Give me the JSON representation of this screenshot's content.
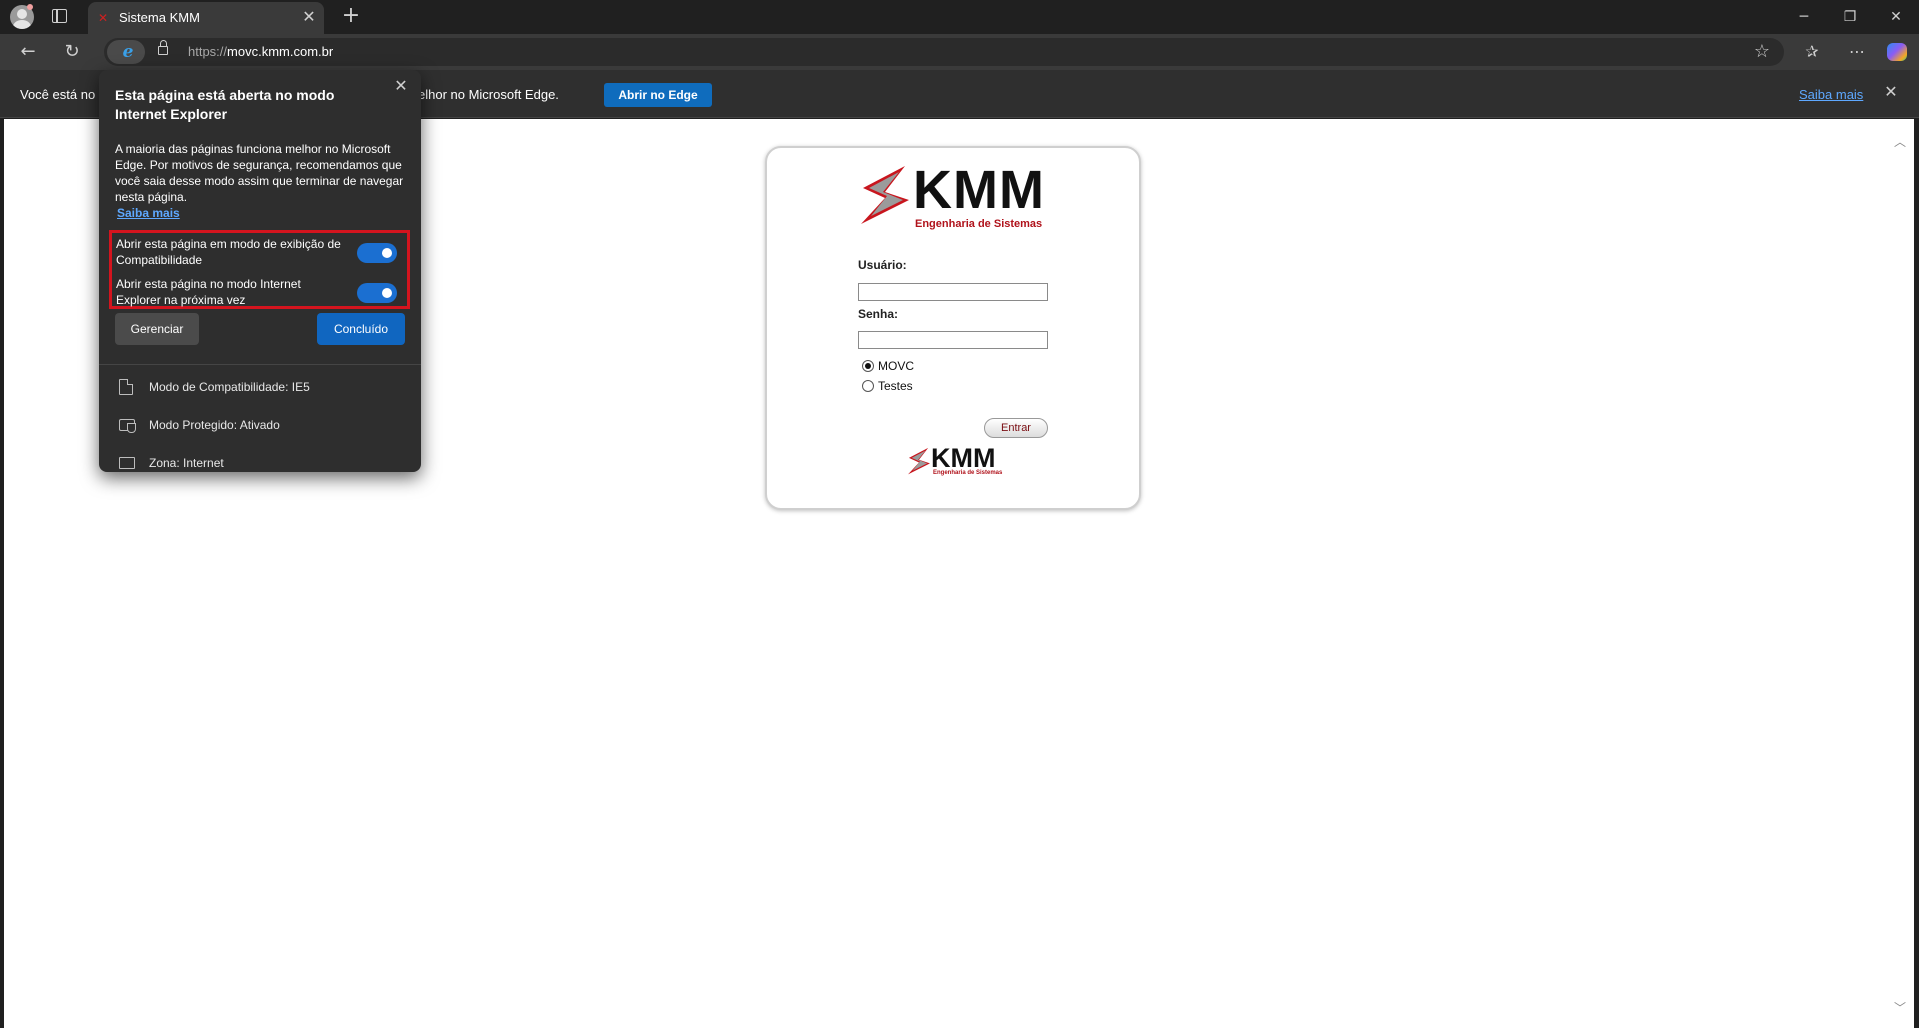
{
  "browser": {
    "tab_title": "Sistema KMM",
    "url_protocol": "https://",
    "url_host": "movc.kmm.com.br"
  },
  "infobar": {
    "text_left": "Você está no m",
    "text_right": "elhor no Microsoft Edge.",
    "open_edge_label": "Abrir no Edge",
    "learn_more": "Saiba mais"
  },
  "popup": {
    "title": "Esta página está aberta no modo Internet Explorer",
    "body": "A maioria das páginas funciona melhor no Microsoft Edge. Por motivos de segurança, recomendamos que você saia desse modo assim que terminar de navegar nesta página.",
    "learn_more": "Saiba mais",
    "toggles": [
      {
        "label": "Abrir esta página em modo de exibição de Compatibilidade",
        "on": true
      },
      {
        "label": "Abrir esta página no modo Internet Explorer na próxima vez",
        "on": true
      }
    ],
    "manage_label": "Gerenciar",
    "done_label": "Concluído",
    "details": [
      {
        "icon": "document-icon",
        "text": "Modo de Compatibilidade: IE5"
      },
      {
        "icon": "shield-icon",
        "text": "Modo Protegido: Ativado"
      },
      {
        "icon": "monitor-icon",
        "text": "Zona: Internet"
      }
    ]
  },
  "login": {
    "logo_text": "KMM",
    "logo_subtitle": "Engenharia de Sistemas",
    "user_label": "Usuário:",
    "user_value": "",
    "password_label": "Senha:",
    "password_value": "",
    "environments": [
      {
        "label": "MOVC",
        "selected": true
      },
      {
        "label": "Testes",
        "selected": false
      }
    ],
    "submit_label": "Entrar"
  },
  "colors": {
    "accent_blue": "#0f6cbd",
    "highlight_red": "#d4141e",
    "brand_red": "#b0121b"
  }
}
